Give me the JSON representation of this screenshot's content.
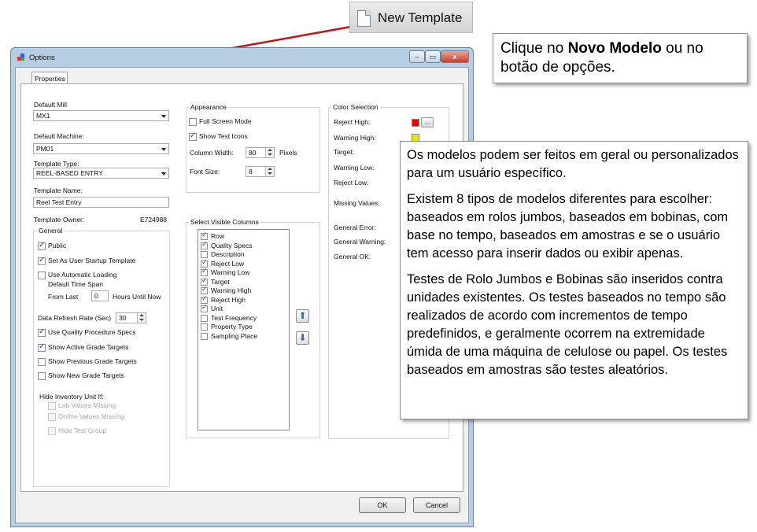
{
  "toolbar": {
    "new_template_label": "New Template",
    "icon": "new-document-icon"
  },
  "callout_top": {
    "text_before": "Clique no ",
    "bold": "Novo Modelo",
    "text_after": " ou no botão de opções."
  },
  "callout_main": {
    "p1": "Os modelos podem ser feitos em geral ou personalizados para um usuário específico.",
    "p2": "Existem 8 tipos de modelos diferentes para escolher: baseados em rolos jumbos, baseados em bobinas, com base no tempo, baseados em amostras e se o usuário tem acesso para inserir dados ou exibir apenas.",
    "p3": "Testes de Rolo Jumbos e Bobinas são inseridos contra unidades existentes. Os testes baseados no tempo são realizados de acordo com incrementos de tempo predefinidos, e geralmente ocorrem na extremidade úmida de uma máquina de celulose ou papel. Os testes baseados em amostras são testes aleatórios."
  },
  "colors": {
    "arrow": "#c0121a",
    "window_frame": "#b7cde4",
    "reject": "#ee0000",
    "warning": "#e8e800"
  },
  "dialog": {
    "title": "Options",
    "title_buttons": {
      "minimize": "–",
      "maximize": "▭",
      "close": "x"
    },
    "tab": "Properties",
    "default_mill": {
      "label": "Default Mill",
      "value": "MX1"
    },
    "default_machine": {
      "label": "Default Machine:",
      "value": "PM01"
    },
    "template_type": {
      "label": "Template Type:",
      "value": "REEL-BASED ENTRY"
    },
    "template_name": {
      "label": "Template Name:",
      "value": "Reel Test Entry"
    },
    "template_owner": {
      "label": "Template Owner:",
      "value": "E724988"
    },
    "general": {
      "title": "General",
      "public": {
        "label": "Public",
        "checked": true
      },
      "startup": {
        "label": "Set As User Startup Template",
        "checked": true
      },
      "auto_loading": {
        "label": "Use Automatic Loading",
        "checked": false
      },
      "default_time_span": "Default Time Span",
      "from_last": "From Last",
      "from_last_value": "0",
      "hours_until_now": "Hours Until Now",
      "refresh_label": "Data Refresh Rate (Sec)",
      "refresh_value": "30",
      "quality_specs": {
        "label": "Use Quality Procedure Specs",
        "checked": true
      },
      "active_targets": {
        "label": "Show Active Grade Targets",
        "checked": true
      },
      "previous_targets": {
        "label": "Show Previous Grade Targets",
        "checked": false
      },
      "new_targets": {
        "label": "Show New Grade Targets",
        "checked": false
      },
      "hide_label": "Hide Inventory Unit If:",
      "lab_missing": "Lab Values Missing",
      "online_missing": "Online Values Missing",
      "hide_test_group": "Hide Test Group"
    },
    "appearance": {
      "title": "Appearance",
      "full_screen": {
        "label": "Full Screen Mode",
        "checked": false
      },
      "test_icons": {
        "label": "Show Test Icons",
        "checked": true
      },
      "column_width_label": "Column Width:",
      "column_width_value": "80",
      "pixels": "Pixels",
      "font_size_label": "Font Size:",
      "font_size_value": "8"
    },
    "columns": {
      "title": "Select Visible Columns",
      "items": [
        {
          "label": "Row",
          "checked": true
        },
        {
          "label": "Quality Specs",
          "checked": true
        },
        {
          "label": "Description",
          "checked": false
        },
        {
          "label": "Reject Low",
          "checked": true
        },
        {
          "label": "Warning Low",
          "checked": true
        },
        {
          "label": "Target",
          "checked": true
        },
        {
          "label": "Warning High",
          "checked": true
        },
        {
          "label": "Reject High",
          "checked": true
        },
        {
          "label": "Unit",
          "checked": true
        },
        {
          "label": "Test Frequency",
          "checked": false
        },
        {
          "label": "Property Type",
          "checked": false
        },
        {
          "label": "Sampling Place",
          "checked": false
        }
      ],
      "up_icon": "arrow-up-icon",
      "down_icon": "arrow-down-icon"
    },
    "color_selection": {
      "title": "Color Selection",
      "reject_high": "Reject High:",
      "warning_high": "Warning High:",
      "target": "Target:",
      "warning_low": "Warning Low:",
      "reject_low": "Reject Low:",
      "missing_values": "Missing Values:",
      "general_error": "General Error:",
      "general_warning": "General Warning:",
      "general_ok": "General OK:",
      "dots": "..."
    },
    "ok": "OK",
    "cancel": "Cancel"
  }
}
